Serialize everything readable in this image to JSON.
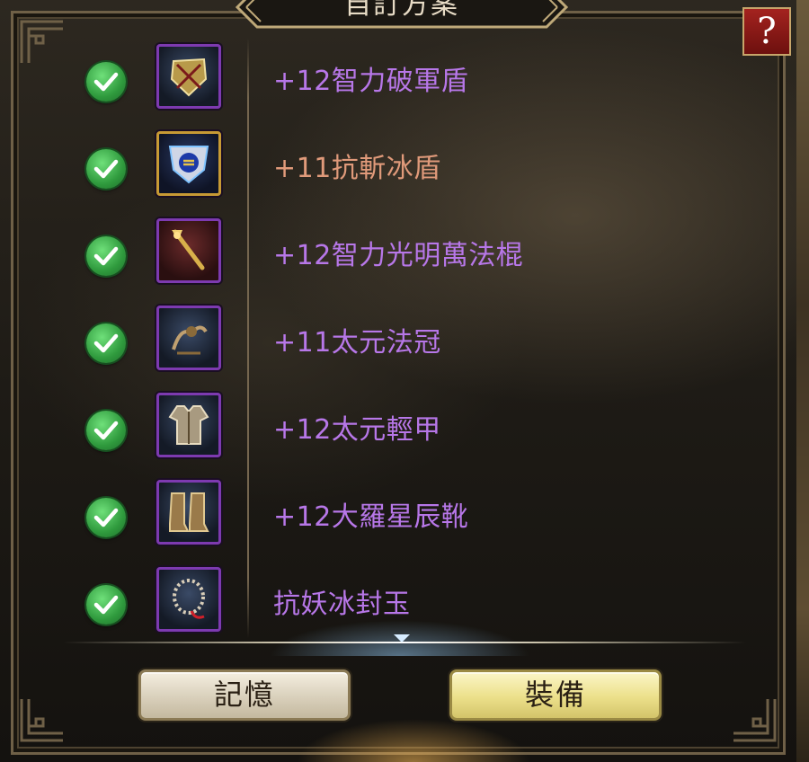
{
  "window": {
    "title": "自訂方案",
    "help_label": "?"
  },
  "items": [
    {
      "name": "+12智力破軍盾",
      "name_color": "#b777e8",
      "icon": "shield-icon",
      "checked": true
    },
    {
      "name": "+11抗斬冰盾",
      "name_color": "#e09a7a",
      "icon": "ice-shield-icon",
      "checked": true
    },
    {
      "name": "+12智力光明萬法棍",
      "name_color": "#b777e8",
      "icon": "staff-icon",
      "checked": true
    },
    {
      "name": "+11太元法冠",
      "name_color": "#b777e8",
      "icon": "crown-icon",
      "checked": true
    },
    {
      "name": "+12太元輕甲",
      "name_color": "#b777e8",
      "icon": "armor-icon",
      "checked": true
    },
    {
      "name": "+12大羅星辰靴",
      "name_color": "#b777e8",
      "icon": "boots-icon",
      "checked": true
    },
    {
      "name": "抗妖冰封玉",
      "name_color": "#b777e8",
      "icon": "bead-necklace-icon",
      "checked": true
    }
  ],
  "buttons": {
    "memory_label": "記憶",
    "equip_label": "裝備"
  },
  "colors": {
    "epic_purple": "#b777e8",
    "legendary_orange": "#e09a7a",
    "check_green": "#2f9a3d"
  }
}
